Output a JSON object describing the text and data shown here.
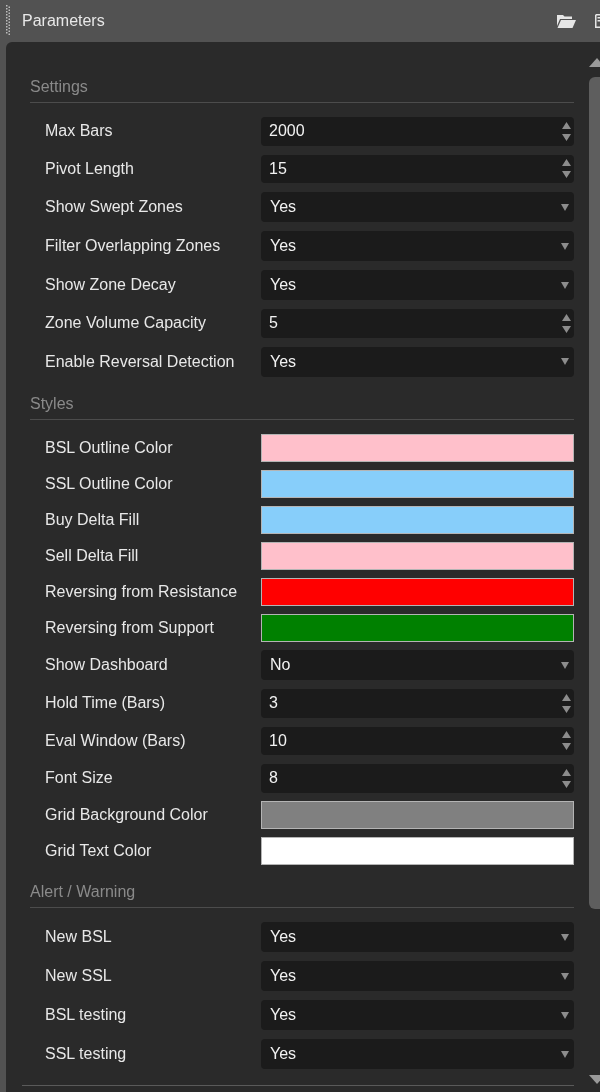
{
  "panel": {
    "title": "Parameters"
  },
  "sections": [
    {
      "title": "Settings",
      "rows": [
        {
          "label": "Max Bars",
          "kind": "number",
          "value": "2000"
        },
        {
          "label": "Pivot Length",
          "kind": "number",
          "value": "15"
        },
        {
          "label": "Show Swept Zones",
          "kind": "select",
          "value": "Yes"
        },
        {
          "label": "Filter Overlapping Zones",
          "kind": "select",
          "value": "Yes"
        },
        {
          "label": "Show Zone Decay",
          "kind": "select",
          "value": "Yes"
        },
        {
          "label": "Zone Volume Capacity",
          "kind": "number",
          "value": "5"
        },
        {
          "label": "Enable Reversal Detection",
          "kind": "select",
          "value": "Yes"
        }
      ]
    },
    {
      "title": "Styles",
      "rows": [
        {
          "label": "BSL Outline Color",
          "kind": "color",
          "color": "#ffc0cb"
        },
        {
          "label": "SSL Outline Color",
          "kind": "color",
          "color": "#87cefa"
        },
        {
          "label": "Buy Delta Fill",
          "kind": "color",
          "color": "#87cefa"
        },
        {
          "label": "Sell Delta Fill",
          "kind": "color",
          "color": "#ffc0cb"
        },
        {
          "label": "Reversing from Resistance",
          "kind": "color",
          "color": "#ff0000"
        },
        {
          "label": "Reversing from Support",
          "kind": "color",
          "color": "#008000"
        },
        {
          "label": "Show Dashboard",
          "kind": "select",
          "value": "No"
        },
        {
          "label": "Hold Time (Bars)",
          "kind": "number",
          "value": "3"
        },
        {
          "label": "Eval Window (Bars)",
          "kind": "number",
          "value": "10"
        },
        {
          "label": "Font Size",
          "kind": "number",
          "value": "8"
        },
        {
          "label": "Grid Background Color",
          "kind": "color",
          "color": "#808080"
        },
        {
          "label": "Grid Text Color",
          "kind": "color",
          "color": "#ffffff"
        }
      ]
    },
    {
      "title": "Alert / Warning",
      "rows": [
        {
          "label": "New BSL",
          "kind": "select",
          "value": "Yes"
        },
        {
          "label": "New SSL",
          "kind": "select",
          "value": "Yes"
        },
        {
          "label": "BSL testing",
          "kind": "select",
          "value": "Yes"
        },
        {
          "label": "SSL testing",
          "kind": "select",
          "value": "Yes"
        }
      ]
    }
  ]
}
